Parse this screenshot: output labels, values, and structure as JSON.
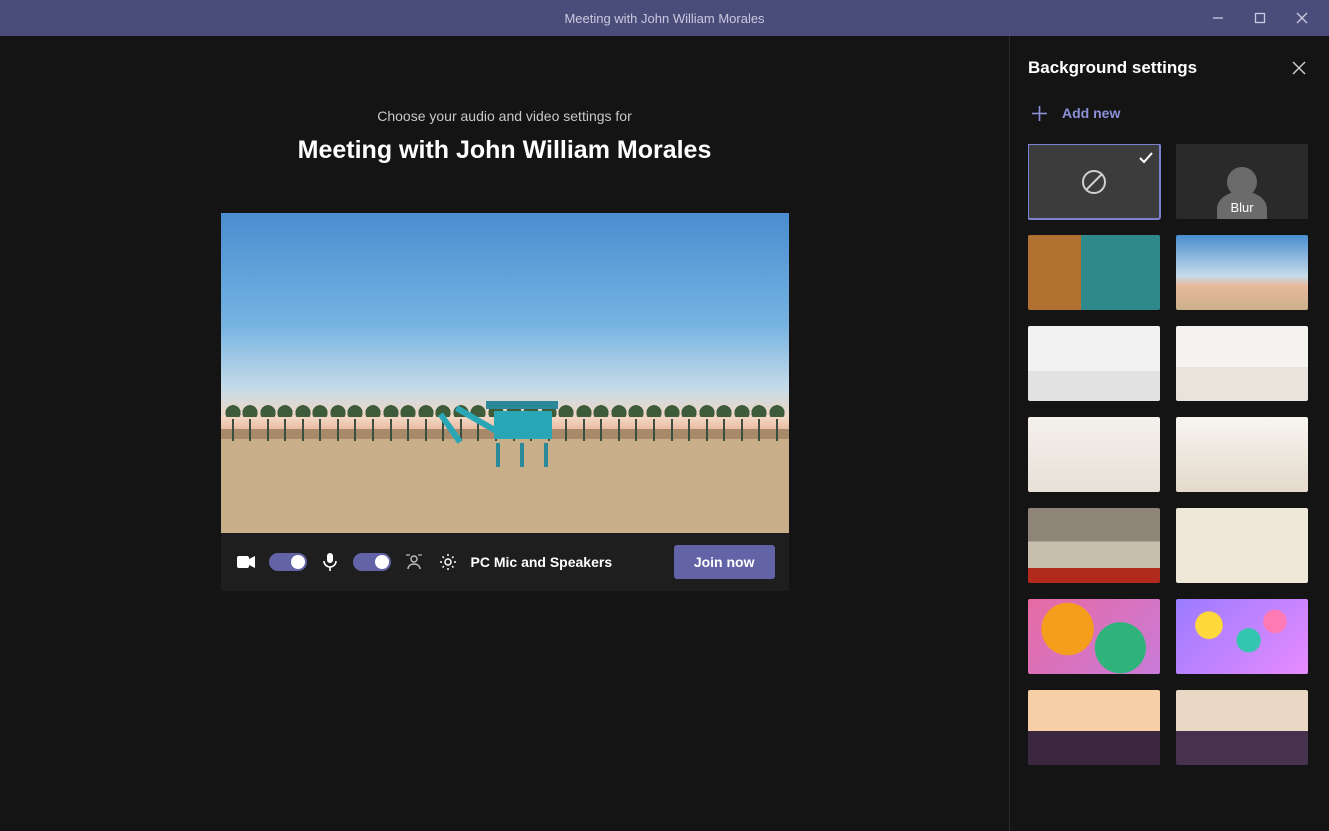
{
  "titlebar": {
    "title": "Meeting with John William Morales"
  },
  "main": {
    "prompt": "Choose your audio and video settings for",
    "meeting_title": "Meeting with John William Morales",
    "device_label": "PC Mic and Speakers",
    "join_label": "Join now"
  },
  "panel": {
    "title": "Background settings",
    "add_new": "Add new",
    "tiles": [
      {
        "id": "none",
        "label": "",
        "kind": "none",
        "selected": true
      },
      {
        "id": "blur",
        "label": "Blur",
        "kind": "blur",
        "selected": false
      },
      {
        "id": "office",
        "label": "",
        "kind": "image",
        "cls": "t-office"
      },
      {
        "id": "beach",
        "label": "",
        "kind": "image",
        "cls": "t-beach"
      },
      {
        "id": "room1",
        "label": "",
        "kind": "image",
        "cls": "t-room1"
      },
      {
        "id": "room2",
        "label": "",
        "kind": "image",
        "cls": "t-room2"
      },
      {
        "id": "white1",
        "label": "",
        "kind": "image",
        "cls": "t-white1"
      },
      {
        "id": "white2",
        "label": "",
        "kind": "image",
        "cls": "t-white2"
      },
      {
        "id": "loft",
        "label": "",
        "kind": "image",
        "cls": "t-loft"
      },
      {
        "id": "empty",
        "label": "",
        "kind": "image",
        "cls": "t-empty"
      },
      {
        "id": "balls1",
        "label": "",
        "kind": "image",
        "cls": "t-balls1"
      },
      {
        "id": "balls2",
        "label": "",
        "kind": "image",
        "cls": "t-balls2"
      },
      {
        "id": "bridge",
        "label": "",
        "kind": "image",
        "cls": "t-bridge"
      },
      {
        "id": "arch",
        "label": "",
        "kind": "image",
        "cls": "t-arch"
      }
    ]
  },
  "colors": {
    "accent": "#6264a7"
  }
}
